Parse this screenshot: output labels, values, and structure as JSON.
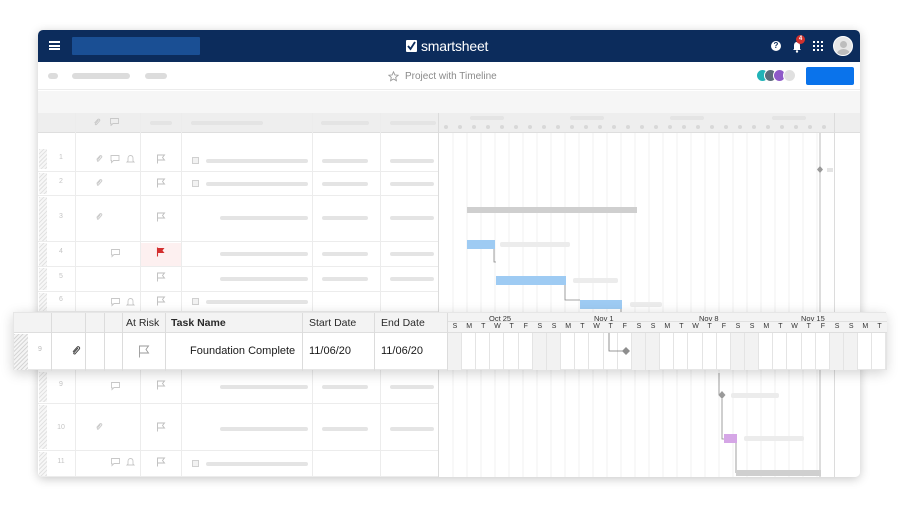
{
  "topbar": {
    "brand": "smartsheet",
    "notification_count": "4"
  },
  "subbar": {
    "sheet_title": "Project with Timeline",
    "collaborator_colors": [
      "#21b3b7",
      "#5c6b7a",
      "#8e5ac8",
      "#d9d9d9"
    ]
  },
  "background_rows": {
    "row_numbers": [
      "1",
      "2",
      "3",
      "4",
      "5",
      "6",
      "9",
      "10",
      "11"
    ]
  },
  "highlighted_row": {
    "headers": {
      "at_risk": "At Risk",
      "task_name": "Task Name",
      "start_date": "Start Date",
      "end_date": "End Date"
    },
    "row_number": "9",
    "task_name": "Foundation Complete",
    "start_date": "11/06/20",
    "end_date": "11/06/20",
    "timeline": {
      "months": [
        "Oct 25",
        "Nov 1",
        "Nov 8",
        "Nov 15"
      ],
      "days": [
        "S",
        "M",
        "T",
        "W",
        "T",
        "F",
        "S",
        "S",
        "M",
        "T",
        "W",
        "T",
        "F",
        "S",
        "S",
        "M",
        "T",
        "W",
        "T",
        "F",
        "S",
        "S",
        "M",
        "T",
        "W",
        "T",
        "F",
        "S",
        "S",
        "M",
        "T"
      ]
    }
  },
  "colors": {
    "topbar": "#0c2c5c",
    "primary_button": "#0a73eb",
    "gantt_blue": "#9ecbf3",
    "gantt_purple": "#d5a6e6",
    "flag_red": "#d32f2f"
  }
}
